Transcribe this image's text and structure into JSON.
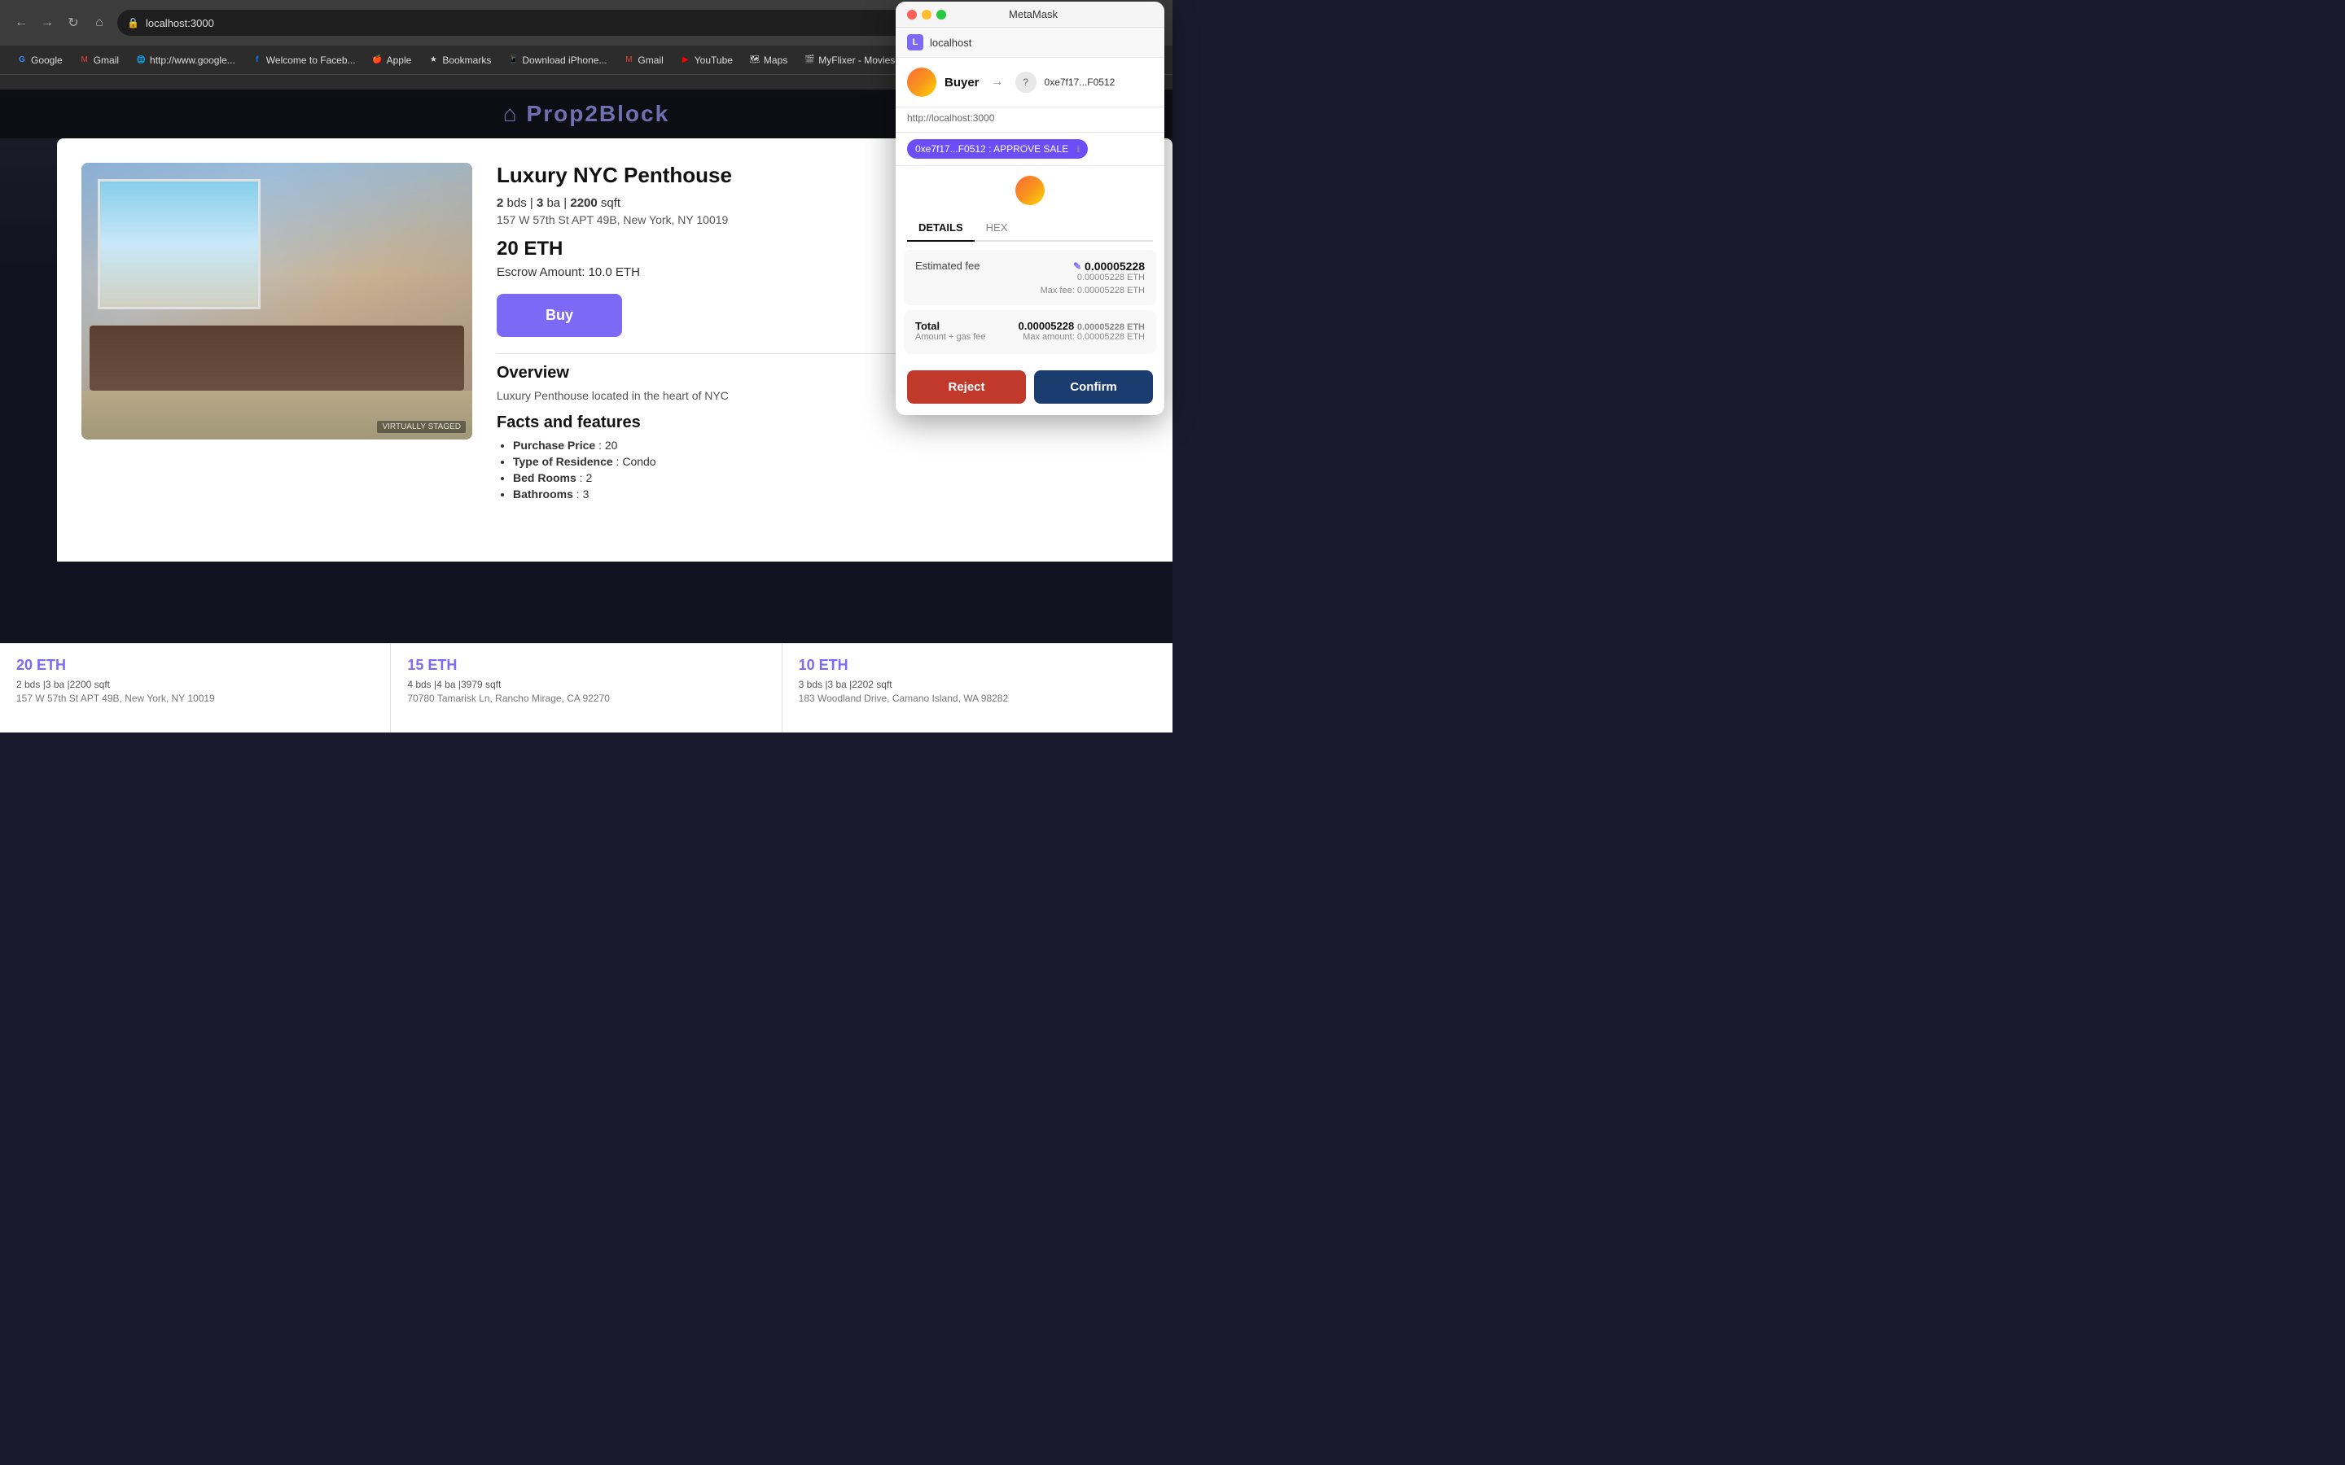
{
  "browser": {
    "address": "localhost:3000",
    "nav": {
      "back": "←",
      "forward": "→",
      "reload": "↻",
      "home": "⌂"
    },
    "bookmarks": [
      {
        "label": "Google",
        "favicon": "G"
      },
      {
        "label": "Gmail",
        "favicon": "M"
      },
      {
        "label": "http://www.google...",
        "favicon": "G"
      },
      {
        "label": "Welcome to Faceb...",
        "favicon": "f"
      },
      {
        "label": "Apple",
        "favicon": ""
      },
      {
        "label": "Bookmarks",
        "favicon": "★"
      },
      {
        "label": "Download iPhone...",
        "favicon": ""
      },
      {
        "label": "Gmail",
        "favicon": "M"
      },
      {
        "label": "YouTube",
        "favicon": "▶"
      },
      {
        "label": "Maps",
        "favicon": ""
      },
      {
        "label": "MyFlixer - Movies",
        "favicon": ""
      }
    ]
  },
  "site": {
    "logo": "Prop2Block",
    "hero_bg": "dark"
  },
  "property": {
    "title": "Luxury NYC Penthouse",
    "beds": "2",
    "baths": "3",
    "sqft": "2200",
    "address": "157 W 57th St APT 49B, New York, NY 10019",
    "price": "20 ETH",
    "escrow_label": "Escrow Amount:",
    "escrow_value": "10.0 ETH",
    "buy_label": "Buy",
    "overview_title": "Overview",
    "overview_text": "Luxury Penthouse located in the heart of NYC",
    "facts_title": "Facts and features",
    "facts": [
      {
        "label": "Purchase Price",
        "value": "20"
      },
      {
        "label": "Type of Residence",
        "value": "Condo"
      },
      {
        "label": "Bed Rooms",
        "value": "2"
      },
      {
        "label": "Bathrooms",
        "value": "3"
      }
    ],
    "staged_label": "VIRTUALLY STAGED"
  },
  "bottom_cards": [
    {
      "price": "20 ETH",
      "specs": "2 bds |3 ba |2200 sqft",
      "address": "157 W 57th St APT 49B, New York, NY 10019"
    },
    {
      "price": "15 ETH",
      "specs": "4 bds |4 ba |3979 sqft",
      "address": "70780 Tamarisk Ln, Rancho Mirage, CA 92270"
    },
    {
      "price": "10 ETH",
      "specs": "3 bds |3 ba |2202 sqft",
      "address": "183 Woodland Drive, Camano Island, WA 98282"
    }
  ],
  "metamask": {
    "title": "MetaMask",
    "dots": [
      "red",
      "yellow",
      "green"
    ],
    "network": "localhost",
    "network_icon": "L",
    "from_account": "Buyer",
    "from_avatar_color": "#ff6b35",
    "arrow": "→",
    "to_icon": "?",
    "to_address": "0xe7f17...F0512",
    "origin": "http://localhost:3000",
    "approve_label": "0xe7f17...F0512 : APPROVE SALE",
    "approve_info": "ℹ",
    "tabs": [
      {
        "label": "DETAILS",
        "active": true
      },
      {
        "label": "HEX",
        "active": false
      }
    ],
    "estimated_fee_label": "Estimated fee",
    "fee_edit_icon": "✎",
    "fee_main": "0.00005228",
    "fee_eth": "0.00005228 ETH",
    "fee_max_label": "Max fee:",
    "fee_max": "0.00005228 ETH",
    "total_label": "Total",
    "total_sub": "Amount + gas fee",
    "total_main": "0.00005228",
    "total_eth": "0.00005228 ETH",
    "total_max_label": "Max amount:",
    "total_max": "0.00005228 ETH",
    "reject_label": "Reject",
    "confirm_label": "Confirm"
  }
}
